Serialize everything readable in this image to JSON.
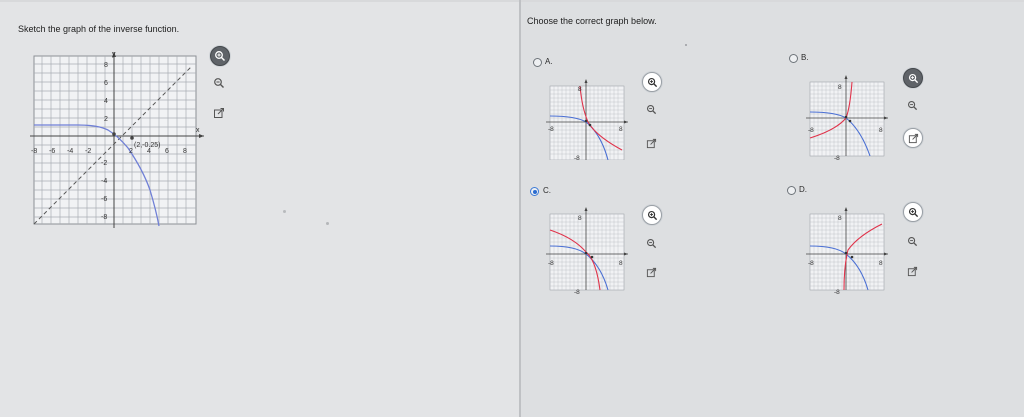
{
  "question": {
    "instruction": "Sketch the graph of the inverse function.",
    "graph": {
      "axis_label_x": "x",
      "axis_label_y": "y",
      "x_ticks": [
        "-8",
        "-6",
        "-4",
        "-2",
        "2",
        "4",
        "6",
        "8"
      ],
      "y_ticks": [
        "8",
        "6",
        "4",
        "2",
        "-2",
        "-4",
        "-6",
        "-8"
      ],
      "point_label": "(2,-0.25)"
    }
  },
  "answer": {
    "prompt": "Choose the correct graph below.",
    "options": [
      {
        "label": "A.",
        "selected": false,
        "tick_top": "8",
        "tick_left": "-8",
        "tick_right": "8",
        "tick_bottom": "-8"
      },
      {
        "label": "B.",
        "selected": false,
        "tick_top": "8",
        "tick_left": "-8",
        "tick_right": "8",
        "tick_bottom": "-8"
      },
      {
        "label": "C.",
        "selected": true,
        "tick_top": "8",
        "tick_left": "-8",
        "tick_right": "8",
        "tick_bottom": "-8"
      },
      {
        "label": "D.",
        "selected": false,
        "tick_top": "8",
        "tick_left": "-8",
        "tick_right": "8",
        "tick_bottom": "-8"
      }
    ]
  },
  "colors": {
    "blue_curve": "#4a6fd4",
    "red_curve": "#e0324a",
    "selected_radio": "#2b6cd1"
  },
  "icons": [
    "zoom-in-icon",
    "zoom-out-icon",
    "open-new-window-icon"
  ]
}
